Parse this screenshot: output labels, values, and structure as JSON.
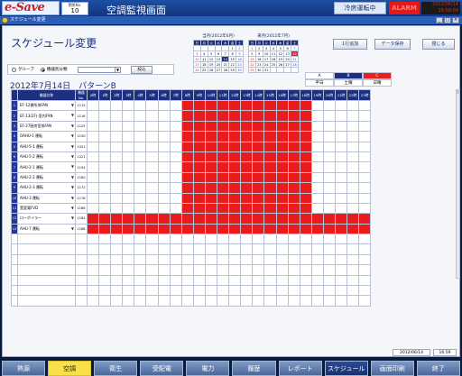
{
  "header": {
    "logo": "e-Save",
    "building_label": "関係No.",
    "building_no": "10",
    "screen_title": "空調監視画面",
    "operation_status": "冷房運転中",
    "alarm": "ALARM",
    "date": "2012/06/14",
    "time": "16:58:09"
  },
  "subtitle": "スケジュール変更",
  "page": {
    "title": "スケジュール変更",
    "date_line": "2012年7月14日　パターンB"
  },
  "calendars": [
    {
      "caption": "当月(2012年6月)",
      "weekdays": [
        "日",
        "月",
        "火",
        "水",
        "木",
        "金",
        "土"
      ],
      "weeks": [
        [
          "",
          "",
          "",
          "",
          "",
          "1",
          "2"
        ],
        [
          "3",
          "4",
          "5",
          "6",
          "7",
          "8",
          "9"
        ],
        [
          "10",
          "11",
          "12",
          "13",
          "14",
          "15",
          "16"
        ],
        [
          "17",
          "18",
          "19",
          "20",
          "21",
          "22",
          "23"
        ],
        [
          "24",
          "25",
          "26",
          "27",
          "28",
          "29",
          "30"
        ]
      ]
    },
    {
      "caption": "来月(2012年7月)",
      "weekdays": [
        "日",
        "月",
        "火",
        "水",
        "木",
        "金",
        "土"
      ],
      "weeks": [
        [
          "1",
          "2",
          "3",
          "4",
          "5",
          "6",
          "7"
        ],
        [
          "8",
          "9",
          "10",
          "11",
          "12",
          "13",
          "14"
        ],
        [
          "15",
          "16",
          "17",
          "18",
          "19",
          "20",
          "21"
        ],
        [
          "22",
          "23",
          "24",
          "25",
          "26",
          "27",
          "28"
        ],
        [
          "29",
          "30",
          "31",
          "",
          "",
          "",
          ""
        ]
      ]
    }
  ],
  "buttons": {
    "add_row": "1行追加",
    "save": "データ保存",
    "close": "閉じる",
    "filter": "絞込"
  },
  "legend": {
    "codes": [
      "A",
      "B",
      "C"
    ],
    "labels": [
      "平日",
      "土曜",
      "日曜"
    ]
  },
  "filter": {
    "option_group": "グループ",
    "option_device": "機器別分類"
  },
  "grid": {
    "header_name": "機器名称",
    "header_code": "機器No.",
    "hours": [
      "0時",
      "1時",
      "2時",
      "3時",
      "4時",
      "5時",
      "6時",
      "7時",
      "8時",
      "9時",
      "10時",
      "11時",
      "12時",
      "13時",
      "14時",
      "15時",
      "16時",
      "17時",
      "18時",
      "19時",
      "20時",
      "21時",
      "22時",
      "23時"
    ],
    "rows": [
      {
        "no": "1",
        "name": "EF-12便所排FAN",
        "code": "1115",
        "on": [
          8,
          19
        ]
      },
      {
        "no": "2",
        "name": "EF-13(2F)-室内FAN",
        "code": "1116",
        "on": [
          8,
          19
        ]
      },
      {
        "no": "3",
        "name": "EF-27厨房室排FAN",
        "code": "1125",
        "on": [
          8,
          19
        ]
      },
      {
        "no": "4",
        "name": "OAHU-1 運転",
        "code": "1150",
        "on": [
          8,
          19
        ]
      },
      {
        "no": "5",
        "name": "AHU-5-1 運転",
        "code": "1201",
        "on": [
          8,
          19
        ]
      },
      {
        "no": "6",
        "name": "AHU-5-2 運転",
        "code": "1221",
        "on": [
          8,
          19
        ]
      },
      {
        "no": "7",
        "name": "AHU-2-1 運転",
        "code": "1154",
        "on": [
          8,
          19
        ]
      },
      {
        "no": "8",
        "name": "AHU-2-2 運転",
        "code": "1160",
        "on": [
          8,
          19
        ]
      },
      {
        "no": "9",
        "name": "AHU-2-3 運転",
        "code": "1172",
        "on": [
          8,
          19
        ]
      },
      {
        "no": "10",
        "name": "AHU-3 運転",
        "code": "1176",
        "on": [
          8,
          19
        ]
      },
      {
        "no": "11",
        "name": "受変電FVD",
        "code": "1186",
        "on": [
          8,
          19
        ]
      },
      {
        "no": "12",
        "name": "ローボイラー",
        "code": "1184",
        "on": [
          0,
          24
        ]
      },
      {
        "no": "13",
        "name": "AHU-7 運転",
        "code": "1186",
        "on": [
          0,
          24
        ]
      }
    ],
    "blank_rows": 7
  },
  "footer": {
    "date": "2012/06/14",
    "time": "16:59"
  },
  "nav": [
    "熱源",
    "空調",
    "衛生",
    "受配電",
    "電力",
    "履歴",
    "レポート",
    "スケジュール",
    "画面印刷(PDF)",
    "終了"
  ],
  "nav_active": "空調",
  "colors": {
    "schedule_on": "#e81c1c",
    "header_navy": "#1c2f80",
    "active_tab": "#f7e04a"
  }
}
